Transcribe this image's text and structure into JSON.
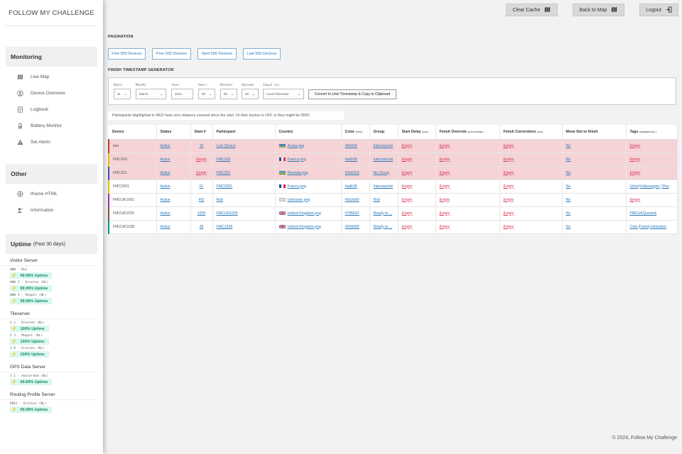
{
  "brand": "FOLLOW MY CHALLENGE",
  "sidebar": {
    "monitoring_title": "Monitoring",
    "monitoring_items": [
      {
        "label": "Live Map",
        "icon": "map-icon"
      },
      {
        "label": "Device Overview",
        "icon": "user-icon"
      },
      {
        "label": "Logbook",
        "icon": "book-icon"
      },
      {
        "label": "Battery Monitor",
        "icon": "battery-icon"
      },
      {
        "label": "Set Alerts",
        "icon": "warning-icon"
      }
    ],
    "other_title": "Other",
    "other_items": [
      {
        "label": "Iframe HTML",
        "icon": "iframe-icon"
      },
      {
        "label": "Information",
        "icon": "info-icon"
      }
    ],
    "uptime_title": "Uptime",
    "uptime_sub": "(Past 30 days)",
    "uptime_groups": [
      {
        "title": "Visitor Server",
        "items": [
          {
            "name": "WWW - Nox",
            "value": "99.96% Uptime"
          },
          {
            "name": "WWW 2 - Dronten (NL)",
            "value": "99.99% Uptime"
          },
          {
            "name": "WWW 3 - Meppel (NL)",
            "value": "99.96% Uptime"
          }
        ]
      },
      {
        "title": "Tileserver",
        "items": [
          {
            "name": "S 1 - Dronten (NL)",
            "value": "100% Uptime"
          },
          {
            "name": "S 3 - Meppel (NL)",
            "value": "100% Uptime"
          },
          {
            "name": "3 D - Dronten (NL)",
            "value": "100% Uptime"
          }
        ]
      },
      {
        "title": "GPS Data Server",
        "items": [
          {
            "name": "S 1 - Amsterdam (NL)",
            "value": "99.89% Uptime"
          }
        ]
      },
      {
        "title": "Routing Profile Server",
        "items": [
          {
            "name": "DNS1 - Dronten (NL)",
            "value": "99.58% Uptime"
          }
        ]
      }
    ]
  },
  "topbar": {
    "clear_cache": "Clear Cache",
    "back_to_map": "Back to Map",
    "logout": "Logout"
  },
  "pagination": {
    "title": "PAGINATION",
    "first": "First 500 Devices",
    "prev": "Prev 500 Devices",
    "next": "Next 500 Devices",
    "last": "Last 500 Devices"
  },
  "generator": {
    "title": "FINISH TIMESTAMP GENERATOR",
    "date_label": "Date:",
    "date_value": "11",
    "month_label": "Month:",
    "month_value": "March",
    "year_label": "Year:",
    "year_value": "2024",
    "hour_label": "Hour:",
    "hour_value": "00",
    "minute_label": "Minute:",
    "minute_value": "00",
    "second_label": "Second:",
    "second_value": "00",
    "input_label": "Input in:",
    "input_value": "Local Timezone",
    "convert_button": "Convert to Unix Timestamp & Copy to Clipboard"
  },
  "notice": "Participants Highlighted in RED have zero distance covered since the start. Or their tracker is OFF or they might be DNS!",
  "table": {
    "headers": {
      "device": "Device",
      "status": "Status",
      "start": "Start #",
      "participant": "Participant",
      "country": "Country",
      "color": "Color",
      "color_small": "(Hex)",
      "group": "Group",
      "start_delay": "Start Delay",
      "start_delay_small": "(min)",
      "finish_overrule": "Finish Overrule",
      "finish_overrule_small": "(unix timesta...",
      "finish_corrections": "Finish Corrections",
      "finish_corrections_small": "(min)",
      "move_dot": "Move Dot to finish",
      "tags": "Tags",
      "tags_small": "separated by |"
    },
    "rows": [
      {
        "device": "iain",
        "status": "Active",
        "start": "15",
        "start_red": false,
        "participant": "Lost Device",
        "country": "Aruba.png",
        "flag": "aruba",
        "color": "#84436",
        "group": "Intermarché",
        "start_delay": "Empty",
        "finish_overrule": "Empty",
        "finish_corrections": "Empty",
        "move_dot": "No",
        "tags": "Empty",
        "tags_red": true,
        "highlight": true,
        "accent": "#c0392b"
      },
      {
        "device": "FMC320",
        "status": "Active",
        "start": "Empty",
        "start_red": true,
        "participant": "FMC320",
        "country": "France.png",
        "flag": "france",
        "color": "#adb35",
        "group": "Intermarché",
        "start_delay": "Empty",
        "finish_overrule": "Empty",
        "finish_corrections": "Empty",
        "move_dot": "No",
        "tags": "Empty",
        "tags_red": true,
        "highlight": true,
        "accent": "#e4c200"
      },
      {
        "device": "FMC321",
        "status": "Active",
        "start": "Empty",
        "start_red": true,
        "participant": "FMC321",
        "country": "Rwanda.png",
        "flag": "rwanda",
        "color": "#3a52b3",
        "group": "No Group",
        "start_delay": "Empty",
        "finish_overrule": "Empty",
        "finish_corrections": "Empty",
        "move_dot": "No",
        "tags": "Empty",
        "tags_red": true,
        "highlight": true,
        "accent": "#3a52b3"
      },
      {
        "device": "FMC2001",
        "status": "Active",
        "start": "01",
        "start_red": false,
        "participant": "FMC2001",
        "country": "France.png",
        "flag": "france",
        "color": "#adb35",
        "group": "Intermarché",
        "start_delay": "Empty",
        "finish_overrule": "Empty",
        "finish_corrections": "Empty",
        "move_dot": "No",
        "tags": "Volvo|Volkswagen | Peu",
        "tags_red": false,
        "highlight": false,
        "accent": "#e4c200"
      },
      {
        "device": "FMCUK1001",
        "status": "Active",
        "start": "RG",
        "start_red": false,
        "participant": "Rob",
        "country": "Unknown.png",
        "flag": "unknown",
        "color": "#9a2eb0",
        "group": "Rob",
        "start_delay": "Empty",
        "finish_overrule": "Empty",
        "finish_corrections": "Empty",
        "move_dot": "No",
        "tags": "Empty",
        "tags_red": true,
        "highlight": false,
        "accent": "#9a2eb0"
      },
      {
        "device": "FMCUK1026",
        "status": "Active",
        "start": "1026",
        "start_red": false,
        "participant": "FMCUK1026",
        "country": "United-Kingdom.png",
        "flag": "uk",
        "color": "#785647",
        "group": "Ready to ...",
        "start_delay": "Empty",
        "finish_overrule": "Empty",
        "finish_corrections": "Empty",
        "move_dot": "No",
        "tags": "FMCUKQuestnk",
        "tags_red": false,
        "highlight": false,
        "accent": "#785647"
      },
      {
        "device": "FMCUK1038",
        "status": "Active",
        "start": "38",
        "start_red": false,
        "participant": "FMC1038",
        "country": "United-Kingdom.png",
        "flag": "uk",
        "color": "#009683",
        "group": "Ready to ...",
        "start_delay": "Empty",
        "finish_overrule": "Empty",
        "finish_corrections": "Empty",
        "move_dot": "No",
        "tags": "Cola |Fanta| Heineken",
        "tags_red": false,
        "highlight": false,
        "accent": "#009683"
      }
    ]
  },
  "footer": "© 2024, Follow My Challenge"
}
